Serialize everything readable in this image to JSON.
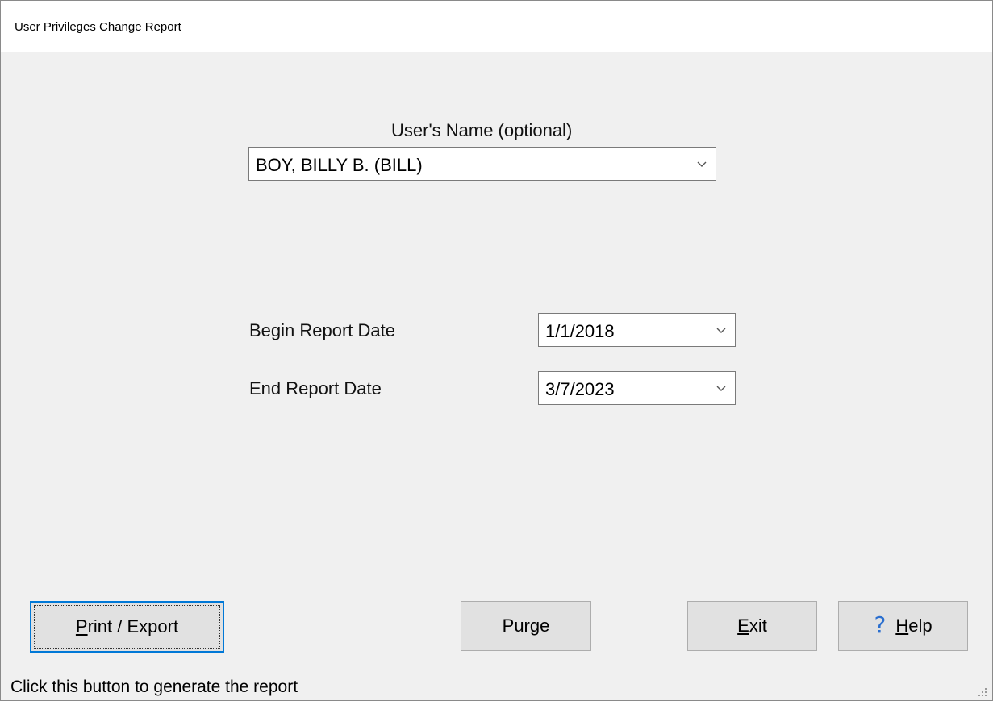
{
  "window": {
    "title": "User Privileges Change Report"
  },
  "users_name": {
    "label": "User's Name (optional)",
    "value": "BOY, BILLY B. (BILL)"
  },
  "begin_date": {
    "label": "Begin Report Date",
    "value": "1/1/2018"
  },
  "end_date": {
    "label": "End Report Date",
    "value": "3/7/2023"
  },
  "buttons": {
    "print_export": {
      "mnemonic": "P",
      "rest": "rint / Export"
    },
    "purge": "Purge",
    "exit": {
      "mnemonic": "E",
      "rest": "xit"
    },
    "help": {
      "icon": "question-mark-icon",
      "glyph": "?",
      "mnemonic": "H",
      "rest": "elp"
    }
  },
  "status": {
    "text": "Click this button to generate the report"
  },
  "colors": {
    "focus_border": "#0078d7",
    "help_icon": "#2b6fcf"
  }
}
